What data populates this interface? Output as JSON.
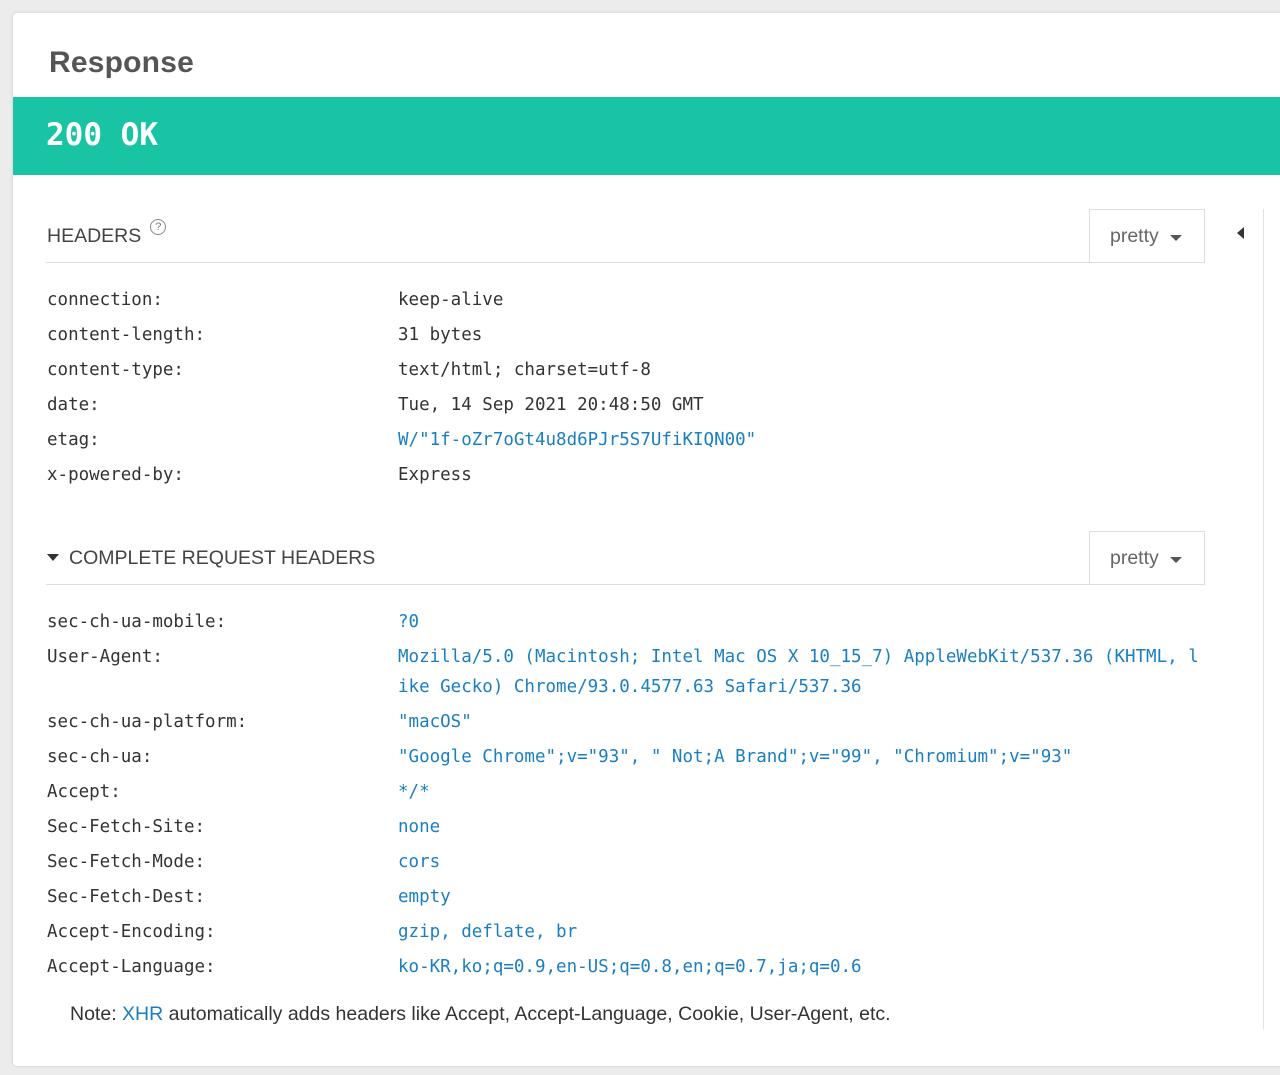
{
  "panel": {
    "title": "Response"
  },
  "status": {
    "text": "200 OK",
    "color": "#19c4a5"
  },
  "headers_section": {
    "title": "HEADERS",
    "help_icon": "?",
    "format_select": "pretty",
    "rows": [
      {
        "key": "connection:",
        "value": "keep-alive",
        "link": false
      },
      {
        "key": "content-length:",
        "value": "31 bytes",
        "link": false
      },
      {
        "key": "content-type:",
        "value": "text/html; charset=utf-8",
        "link": false
      },
      {
        "key": "date:",
        "value": "Tue, 14 Sep 2021 20:48:50 GMT",
        "link": false
      },
      {
        "key": "etag:",
        "value": "W/\"1f-oZr7oGt4u8d6PJr5S7UfiKIQN00\"",
        "link": true
      },
      {
        "key": "x-powered-by:",
        "value": "Express",
        "link": false
      }
    ]
  },
  "request_section": {
    "title": "COMPLETE REQUEST HEADERS",
    "format_select": "pretty",
    "rows": [
      {
        "key": "sec-ch-ua-mobile:",
        "value": "?0"
      },
      {
        "key": "User-Agent:",
        "value": "Mozilla/5.0 (Macintosh; Intel Mac OS X 10_15_7) AppleWebKit/537.36 (KHTML, like Gecko) Chrome/93.0.4577.63 Safari/537.36"
      },
      {
        "key": "sec-ch-ua-platform:",
        "value": "\"macOS\""
      },
      {
        "key": "sec-ch-ua:",
        "value": "\"Google Chrome\";v=\"93\", \" Not;A Brand\";v=\"99\", \"Chromium\";v=\"93\""
      },
      {
        "key": "Accept:",
        "value": "*/*"
      },
      {
        "key": "Sec-Fetch-Site:",
        "value": "none"
      },
      {
        "key": "Sec-Fetch-Mode:",
        "value": "cors"
      },
      {
        "key": "Sec-Fetch-Dest:",
        "value": "empty"
      },
      {
        "key": "Accept-Encoding:",
        "value": "gzip, deflate, br"
      },
      {
        "key": "Accept-Language:",
        "value": "ko-KR,ko;q=0.9,en-US;q=0.8,en;q=0.7,ja;q=0.6"
      }
    ]
  },
  "note": {
    "prefix": "Note: ",
    "link": "XHR",
    "suffix": " automatically adds headers like Accept, Accept-Language, Cookie, User-Agent, etc."
  },
  "link_color": "#1a7fc1"
}
